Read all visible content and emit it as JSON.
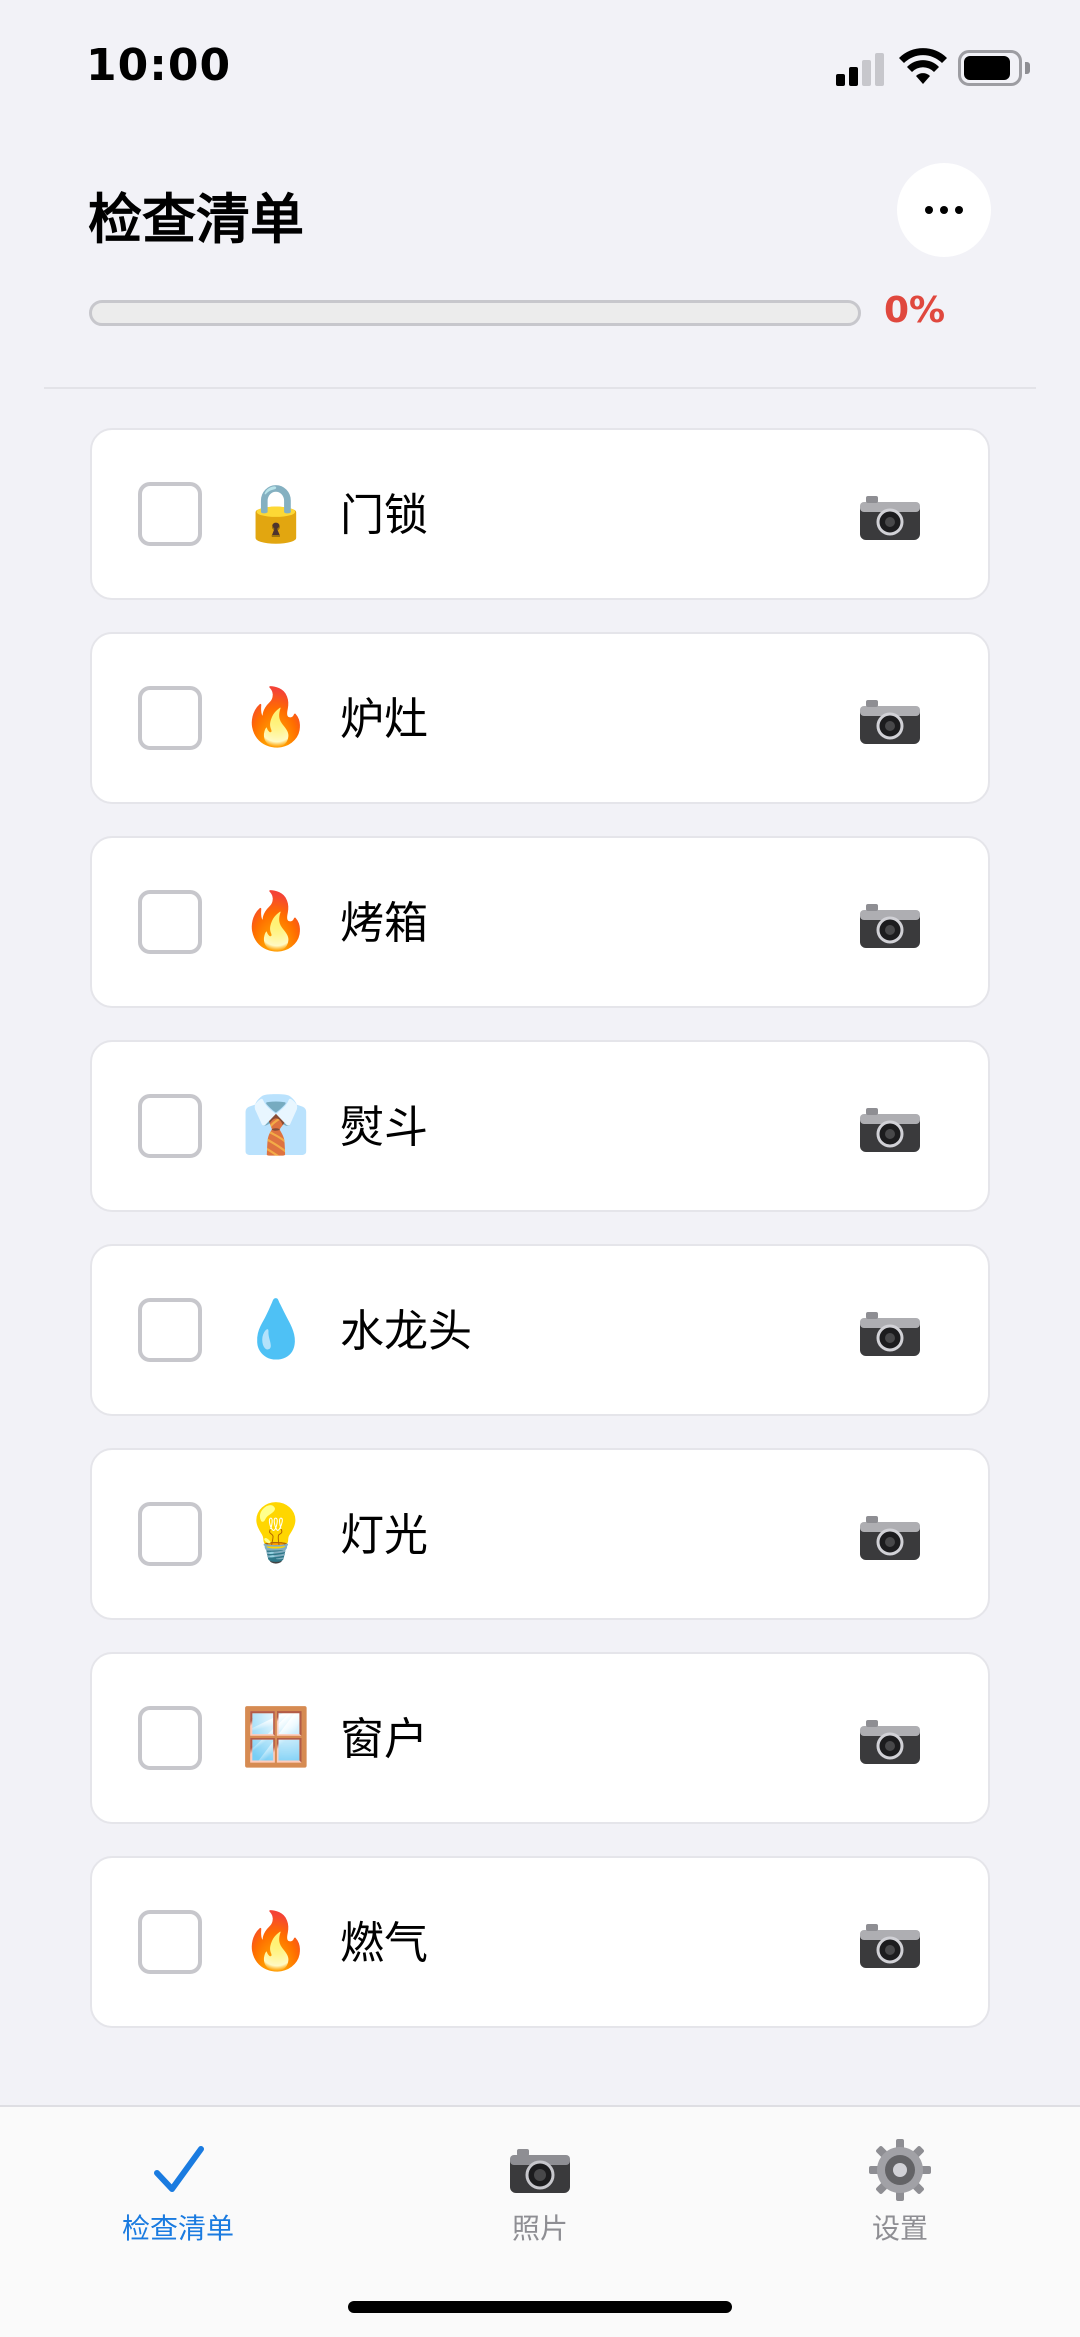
{
  "status_bar": {
    "time": "10:00"
  },
  "header": {
    "title": "检查清单",
    "more_icon": "ellipsis-icon"
  },
  "progress": {
    "value": 0,
    "label": "0%",
    "color": "#e0483e"
  },
  "items": [
    {
      "label": "门锁",
      "emoji": "🔒",
      "icon": "lock-icon",
      "checked": false
    },
    {
      "label": "炉灶",
      "emoji": "🔥",
      "icon": "fire-icon",
      "checked": false
    },
    {
      "label": "烤箱",
      "emoji": "🔥",
      "icon": "fire-icon",
      "checked": false
    },
    {
      "label": "熨斗",
      "emoji": "👔",
      "icon": "shirt-icon",
      "checked": false
    },
    {
      "label": "水龙头",
      "emoji": "💧",
      "icon": "droplet-icon",
      "checked": false
    },
    {
      "label": "灯光",
      "emoji": "💡",
      "icon": "light-bulb-icon",
      "checked": false
    },
    {
      "label": "窗户",
      "emoji": "🪟",
      "icon": "window-icon",
      "checked": false
    },
    {
      "label": "燃气",
      "emoji": "🔥",
      "icon": "fire-icon",
      "checked": false
    }
  ],
  "tabs": [
    {
      "label": "检查清单",
      "icon": "checkmark-icon",
      "active": true
    },
    {
      "label": "照片",
      "icon": "camera-icon",
      "active": false
    },
    {
      "label": "设置",
      "icon": "gear-icon",
      "active": false
    }
  ],
  "colors": {
    "accent": "#1a7be0",
    "background": "#f2f2f7"
  }
}
